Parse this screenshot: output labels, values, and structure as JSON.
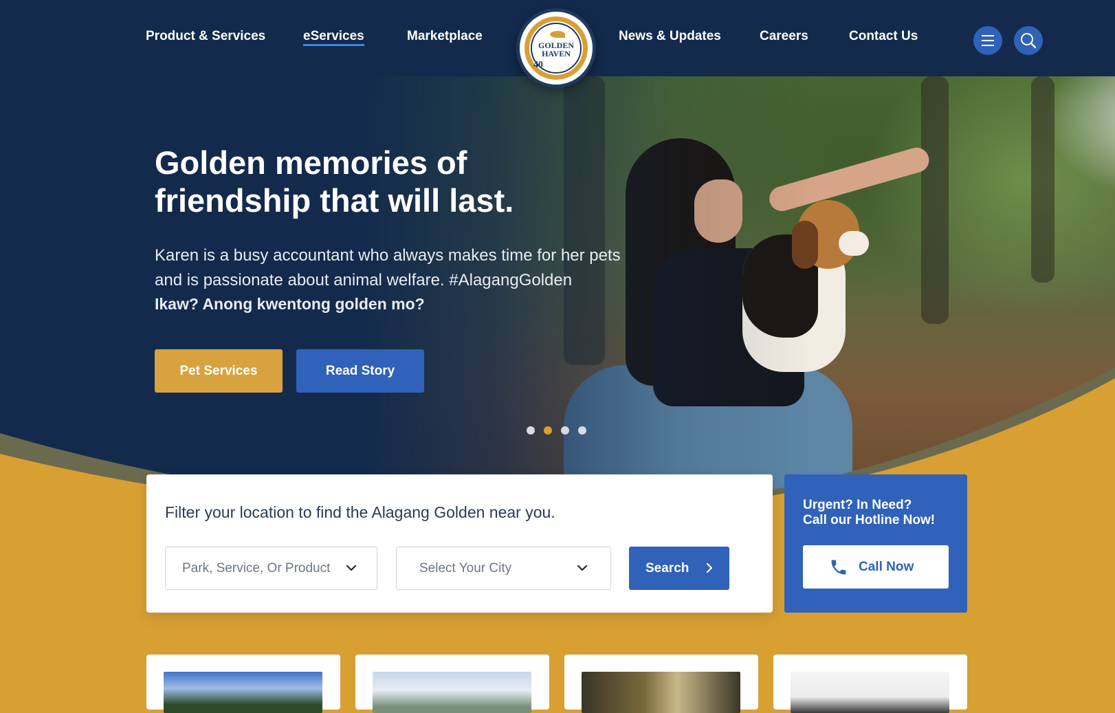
{
  "nav": {
    "links": [
      "Product & Services",
      "eServices",
      "Marketplace",
      "News & Updates",
      "Careers",
      "Contact Us"
    ],
    "active": "eServices",
    "logo": {
      "line1": "GOLDEN",
      "line2": "HAVEN",
      "badge": "40"
    },
    "menu_icon": "hamburger-menu-icon",
    "search_icon": "search-icon"
  },
  "hero": {
    "title_line1": "Golden memories of",
    "title_line2": "friendship that will last.",
    "description": "Karen is a busy accountant who always makes time for her pets and is passionate about animal welfare. #AlagangGolden",
    "question": "Ikaw? Anong kwentong golden mo?",
    "primary_button": "Pet Services",
    "secondary_button": "Read Story",
    "carousel": {
      "slides": 4,
      "active_index": 1
    }
  },
  "search": {
    "title": "Filter your location to find the Alagang Golden near you.",
    "select1_placeholder": "Park, Service, Or Product",
    "select2_placeholder": "Select Your City",
    "button_label": "Search"
  },
  "hotline": {
    "line1": "Urgent? In Need?",
    "line2": "Call our Hotline Now!",
    "button_label": "Call Now",
    "icon": "phone-icon"
  },
  "colors": {
    "navy": "#132a4c",
    "gold": "#d89f33",
    "blue": "#2f62b8",
    "white": "#ffffff"
  }
}
